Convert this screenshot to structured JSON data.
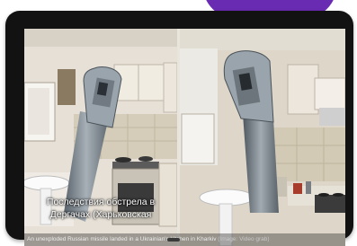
{
  "overlay": {
    "line1": "Последствия обстрела в",
    "line2": "Дергачах (Харьковская"
  },
  "caption": {
    "text": "An unexploded Russian missile landed in a Ukrainian's kitchen in Kharkiv",
    "source": "(Image: Video grab)"
  },
  "colors": {
    "accent": "#6a2bb3",
    "device": "#121212",
    "missile": "#8a949c"
  }
}
